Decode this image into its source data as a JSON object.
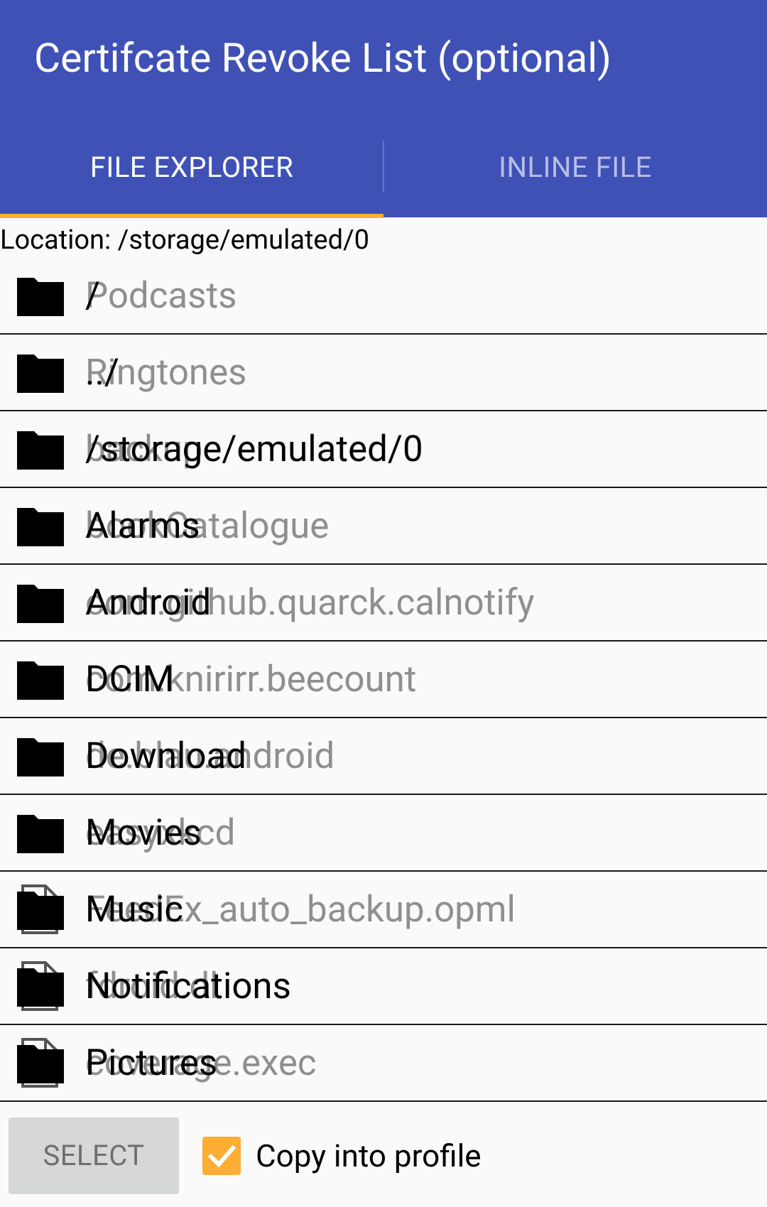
{
  "title": "Certifcate Revoke List (optional)",
  "tabs": [
    {
      "label": "FILE EXPLORER",
      "selected": true
    },
    {
      "label": "INLINE FILE",
      "selected": false
    }
  ],
  "location_label": "Location: /storage/emulated/0",
  "ghost_items": [
    {
      "label": "Podcasts",
      "icon": "folder-icon"
    },
    {
      "label": "Ringtones",
      "icon": "folder-icon"
    },
    {
      "label": "backup",
      "icon": "folder-icon"
    },
    {
      "label": "bookCatalogue",
      "icon": "folder-icon"
    },
    {
      "label": "com.github.quarck.calnotify",
      "icon": "folder-icon"
    },
    {
      "label": "com.knirirr.beecount",
      "icon": "folder-icon"
    },
    {
      "label": "de.blau.android",
      "icon": "folder-icon"
    },
    {
      "label": "easyxkcd",
      "icon": "folder-icon"
    },
    {
      "label": "FeedEx_auto_backup.opml",
      "icon": "file-icon"
    },
    {
      "label": "fdroid.dl",
      "icon": "file-icon"
    },
    {
      "label": "coverage.exec",
      "icon": "file-icon"
    }
  ],
  "items": [
    {
      "label": "/"
    },
    {
      "label": "../"
    },
    {
      "label": "/storage/emulated/0"
    },
    {
      "label": "Alarms"
    },
    {
      "label": "Android"
    },
    {
      "label": "DCIM"
    },
    {
      "label": "Download"
    },
    {
      "label": "Movies"
    },
    {
      "label": "Music"
    },
    {
      "label": "Notifications"
    },
    {
      "label": "Pictures"
    }
  ],
  "bottom": {
    "select_label": "SELECT",
    "checkbox_label": "Copy into profile",
    "checkbox_checked": true
  },
  "colors": {
    "primary": "#3f51b5",
    "accent": "#ffae35",
    "button_bg": "#d6d7d7"
  }
}
